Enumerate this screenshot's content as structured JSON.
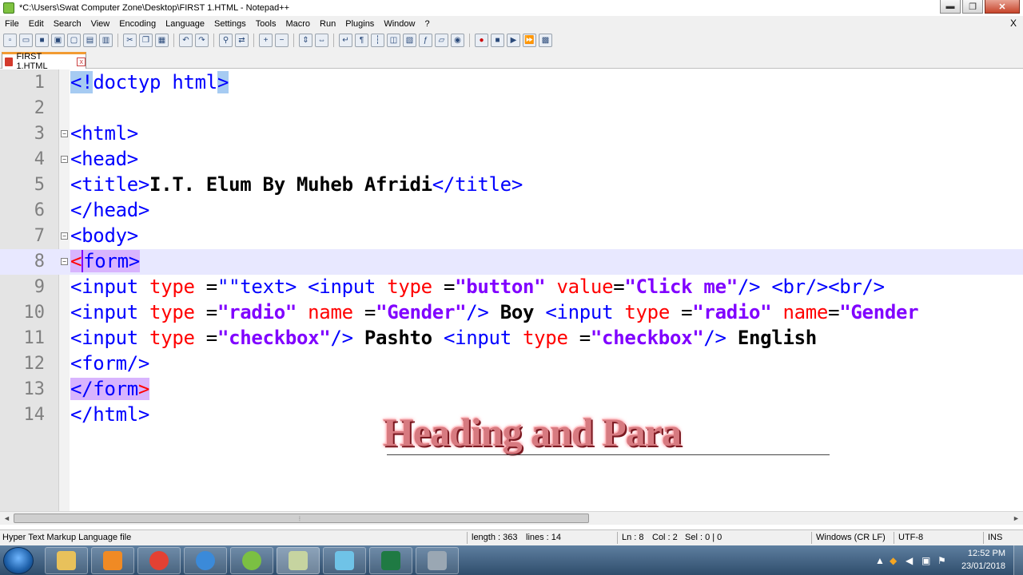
{
  "window": {
    "title": "*C:\\Users\\Swat Computer Zone\\Desktop\\FIRST 1.HTML - Notepad++",
    "minimize": "▬",
    "maximize": "❐",
    "close": "✕"
  },
  "menu": {
    "items": [
      "File",
      "Edit",
      "Search",
      "View",
      "Encoding",
      "Language",
      "Settings",
      "Tools",
      "Macro",
      "Run",
      "Plugins",
      "Window",
      "?"
    ],
    "close_x": "X"
  },
  "toolbar": {
    "icons": [
      "new-file-icon",
      "open-file-icon",
      "save-icon",
      "save-all-icon",
      "close-icon",
      "close-all-icon",
      "print-icon",
      "cut-icon",
      "copy-icon",
      "paste-icon",
      "undo-icon",
      "redo-icon",
      "find-icon",
      "replace-icon",
      "zoom-in-icon",
      "zoom-out-icon",
      "sync-vertical-icon",
      "sync-horizontal-icon",
      "word-wrap-icon",
      "show-all-chars-icon",
      "indent-guide-icon",
      "user-language-icon",
      "doc-map-icon",
      "function-list-icon",
      "folder-workspace-icon",
      "monitoring-icon",
      "record-macro-icon",
      "stop-record-icon",
      "play-macro-icon",
      "run-macro-multiple-icon",
      "save-macro-icon"
    ]
  },
  "tab": {
    "label": "FIRST 1.HTML",
    "close": "x"
  },
  "editor": {
    "line_numbers": [
      "1",
      "2",
      "3",
      "4",
      "5",
      "6",
      "7",
      "8",
      "9",
      "10",
      "11",
      "12",
      "13",
      "14"
    ],
    "line1": {
      "open": "<!",
      "rest": "doctyp html",
      "close": ">"
    },
    "line3": {
      "tag": "<html>"
    },
    "line4": {
      "tag": "<head>"
    },
    "line5": {
      "open": "<title>",
      "text": "I.T. Elum By Muheb Afridi",
      "close": "</title>"
    },
    "line6": {
      "tag": "</head>"
    },
    "line7": {
      "tag": "<body>"
    },
    "line8": {
      "lt": "<",
      "rest": "form>"
    },
    "line9": {
      "t1": "<input ",
      "a1": "type ",
      "eq1": "=",
      "q1": "\"\"",
      "t2": "text> <input ",
      "a2": "type ",
      "eq2": "=",
      "s1": "\"button\" ",
      "a3": "value",
      "eq3": "=",
      "s2": "\"Click me\"",
      "t3": "/> <br/><br/>"
    },
    "line10": {
      "t1": "<input ",
      "a1": "type ",
      "eq1": "=",
      "s1": "\"radio\" ",
      "a2": "name ",
      "eq2": "=",
      "s2": "\"Gender\"",
      "t2": "/> ",
      "x1": "Boy ",
      "t3": "<input ",
      "a3": "type ",
      "eq3": "=",
      "s3": "\"radio\" ",
      "a4": "name",
      "eq4": "=",
      "s4": "\"Gender"
    },
    "line11": {
      "t1": "<input ",
      "a1": "type ",
      "eq1": "=",
      "s1": "\"checkbox\"",
      "t2": "/> ",
      "x1": "Pashto ",
      "t3": "<input ",
      "a2": "type ",
      "eq2": "=",
      "s2": "\"checkbox\"",
      "t4": "/> ",
      "x2": "English"
    },
    "line12": {
      "tag": "<form/>"
    },
    "line13": {
      "open": "</form",
      "close": ">"
    },
    "line14": {
      "tag": "</html>"
    }
  },
  "overlay": {
    "heading": "Heading and Para"
  },
  "scrollbar": {
    "left": "◄",
    "right": "►",
    "grip": "⦙"
  },
  "status": {
    "language": "Hyper Text Markup Language file",
    "length": "length : 363",
    "lines": "lines : 14",
    "ln": "Ln : 8",
    "col": "Col : 2",
    "sel": "Sel : 0 | 0",
    "eol": "Windows (CR LF)",
    "encoding": "UTF-8",
    "mode": "INS"
  },
  "taskbar": {
    "apps": [
      "file-explorer-icon",
      "media-player-icon",
      "chrome-icon",
      "internet-explorer-icon",
      "utorrent-icon",
      "notepad-plus-plus-icon",
      "windows-store-icon",
      "excel-icon",
      "network-computer-icon"
    ],
    "app_colors": [
      "#e8c15b",
      "#f08a24",
      "#e34133",
      "#3b8ad9",
      "#7bc043",
      "#c6d4a0",
      "#6fc3e7",
      "#1f7a43",
      "#9aa7b3"
    ],
    "tray_up": "▲",
    "clock_time": "12:52 PM",
    "clock_date": "23/01/2018"
  }
}
